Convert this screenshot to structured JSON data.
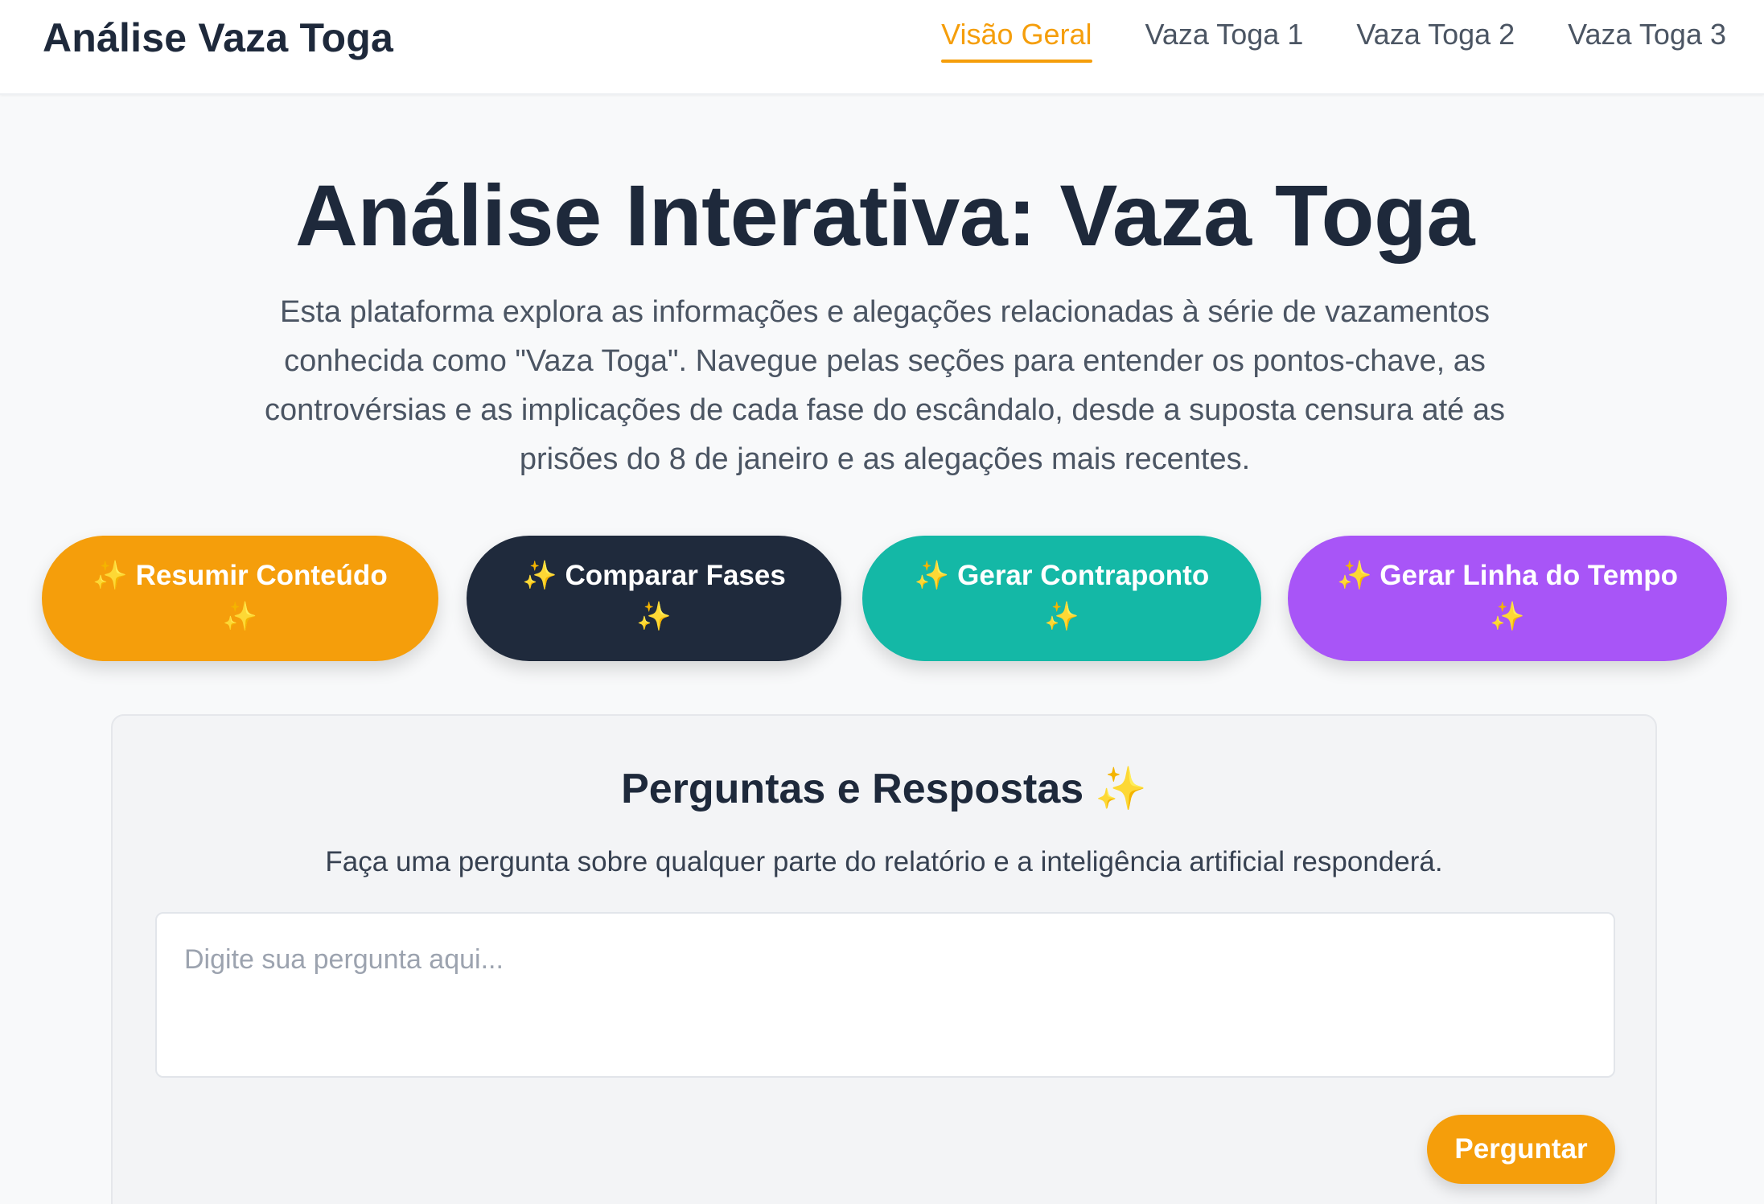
{
  "header": {
    "brand": "Análise Vaza Toga",
    "nav": [
      {
        "label": "Visão Geral",
        "active": true
      },
      {
        "label": "Vaza Toga 1",
        "active": false
      },
      {
        "label": "Vaza Toga 2",
        "active": false
      },
      {
        "label": "Vaza Toga 3",
        "active": false
      }
    ]
  },
  "hero": {
    "title": "Análise Interativa: Vaza Toga",
    "description": "Esta plataforma explora as informações e alegações relacionadas à série de vazamentos conhecida como \"Vaza Toga\". Navegue pelas seções para entender os pontos-chave, as controvérsias e as implicações de cada fase do escândalo, desde a suposta censura até as prisões do 8 de janeiro e as alegações mais recentes."
  },
  "actions": {
    "spark_icon": "✨",
    "items": [
      {
        "label": "Resumir Conteúdo",
        "color": "#f59e0b"
      },
      {
        "label": "Comparar Fases",
        "color": "#1f2a3c"
      },
      {
        "label": "Gerar Contraponto",
        "color": "#14b8a6"
      },
      {
        "label": "Gerar Linha do Tempo",
        "color": "#a855f7"
      }
    ]
  },
  "qa": {
    "title": "Perguntas e Respostas",
    "subtitle": "Faça uma pergunta sobre qualquer parte do relatório e a inteligência artificial responderá.",
    "placeholder": "Digite sua pergunta aqui...",
    "value": "",
    "button_label": "Perguntar"
  },
  "colors": {
    "accent": "#f59e0b",
    "dark": "#1e293b"
  }
}
